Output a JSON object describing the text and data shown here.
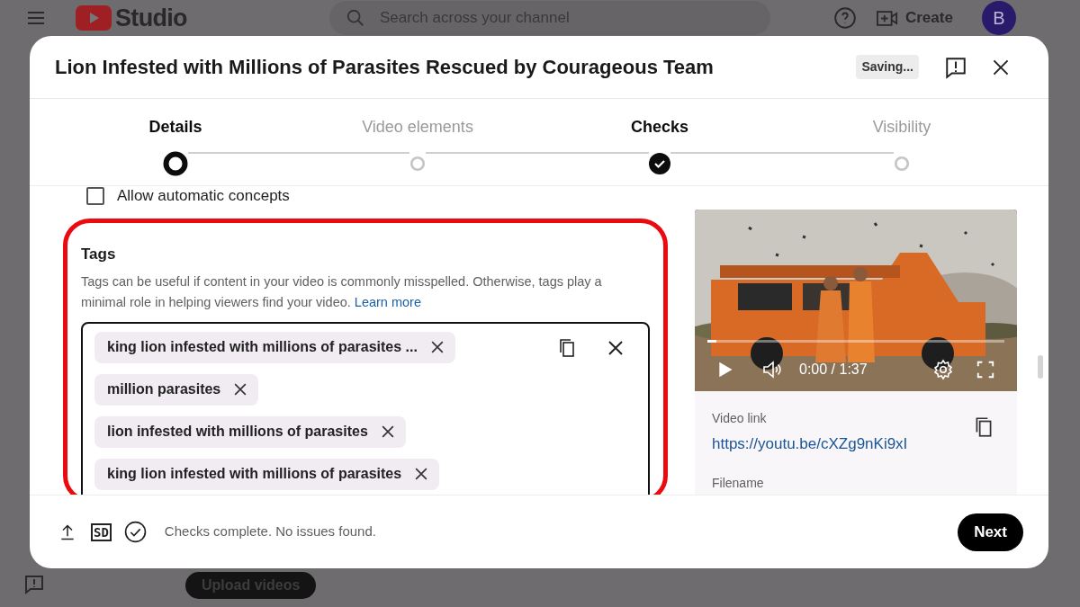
{
  "app_header": {
    "logo_text": "Studio",
    "search_placeholder": "Search across your channel",
    "create_label": "Create",
    "avatar_letter": "B"
  },
  "background_button": "Upload videos",
  "dialog": {
    "title": "Lion Infested with Millions of Parasites Rescued by Courageous Team",
    "save_status": "Saving..."
  },
  "steps": [
    {
      "label": "Details",
      "selected": true,
      "done": false
    },
    {
      "label": "Video elements",
      "selected": false,
      "done": false
    },
    {
      "label": "Checks",
      "selected": false,
      "done": true
    },
    {
      "label": "Visibility",
      "selected": false,
      "done": false
    }
  ],
  "concepts_checkbox": {
    "label": "Allow automatic concepts",
    "checked": false
  },
  "tags": {
    "heading": "Tags",
    "description": "Tags can be useful if content in your video is commonly misspelled. Otherwise, tags play a minimal role in helping viewers find your video.",
    "learn_more": "Learn more",
    "chips": [
      "king lion infested with millions of parasites ...",
      "million parasites",
      "lion infested with millions of parasites",
      "king lion infested with millions of parasites"
    ]
  },
  "video": {
    "time": "0:00 / 1:37",
    "level": 0.03
  },
  "video_link": {
    "label": "Video link",
    "url": "https://youtu.be/cXZg9nKi9xI"
  },
  "filename_label": "Filename",
  "footer": {
    "quality_badge": "SD",
    "status": "Checks complete. No issues found.",
    "next": "Next"
  }
}
